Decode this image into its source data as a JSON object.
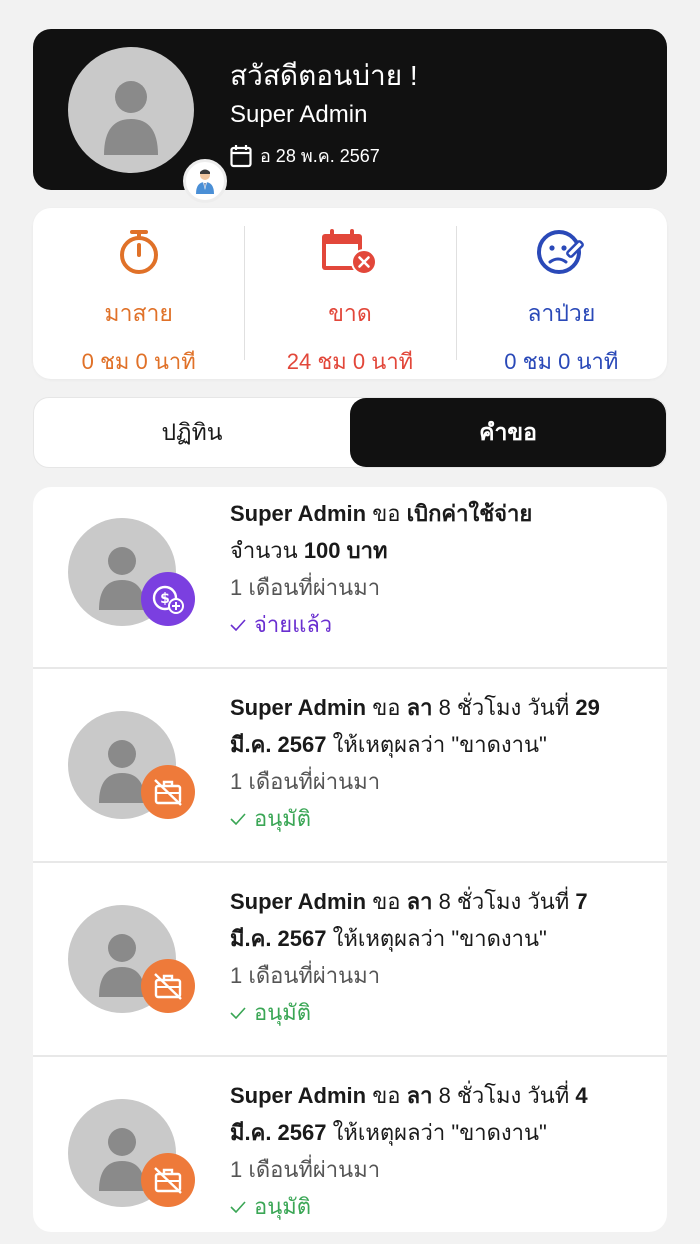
{
  "header": {
    "greeting": "สวัสดีตอนบ่าย !",
    "username": "Super Admin",
    "date": "อ 28 พ.ค. 2567",
    "avatar_icon": "person-placeholder-icon",
    "role_badge_icon": "businessman-icon"
  },
  "stats": [
    {
      "label": "มาสาย",
      "value": "0 ชม 0 นาที",
      "color": "#e07128",
      "icon": "stopwatch-icon"
    },
    {
      "label": "ขาด",
      "value": "24 ชม 0 นาที",
      "color": "#e2473a",
      "icon": "calendar-x-icon"
    },
    {
      "label": "ลาป่วย",
      "value": "0 ชม 0 นาที",
      "color": "#2a49b8",
      "icon": "sick-face-icon"
    }
  ],
  "tabs": [
    {
      "label": "ปฏิทิน",
      "active": false
    },
    {
      "label": "คำขอ",
      "active": true
    }
  ],
  "requests": [
    {
      "user": "Super Admin",
      "verb": "ขอ",
      "type": "เบิกค่าใช้จ่าย",
      "line2_prefix": "จำนวน",
      "amount": "100 บาท",
      "time": "1 เดือนที่ผ่านมา",
      "status": "จ่ายแล้ว",
      "status_color": "#6a2fd0",
      "badge_color": "#7b3fe0",
      "badge_icon": "money-add-icon"
    },
    {
      "user": "Super Admin",
      "verb": "ขอ",
      "type": "ลา",
      "hours": "8 ชั่วโมง วันที่",
      "day": "29",
      "month_year": "มี.ค. 2567",
      "reason_prefix": "ให้เหตุผลว่า",
      "reason": "\"ขาดงาน\"",
      "time": "1 เดือนที่ผ่านมา",
      "status": "อนุมัติ",
      "status_color": "#3aa655",
      "badge_color": "#ee7a3a",
      "badge_icon": "briefcase-off-icon"
    },
    {
      "user": "Super Admin",
      "verb": "ขอ",
      "type": "ลา",
      "hours": "8 ชั่วโมง วันที่",
      "day": "7",
      "month_year": "มี.ค. 2567",
      "reason_prefix": "ให้เหตุผลว่า",
      "reason": "\"ขาดงาน\"",
      "time": "1 เดือนที่ผ่านมา",
      "status": "อนุมัติ",
      "status_color": "#3aa655",
      "badge_color": "#ee7a3a",
      "badge_icon": "briefcase-off-icon"
    },
    {
      "user": "Super Admin",
      "verb": "ขอ",
      "type": "ลา",
      "hours": "8 ชั่วโมง วันที่",
      "day": "4",
      "month_year": "มี.ค. 2567",
      "reason_prefix": "ให้เหตุผลว่า",
      "reason": "\"ขาดงาน\"",
      "time": "1 เดือนที่ผ่านมา",
      "status": "อนุมัติ",
      "status_color": "#3aa655",
      "badge_color": "#ee7a3a",
      "badge_icon": "briefcase-off-icon"
    }
  ]
}
